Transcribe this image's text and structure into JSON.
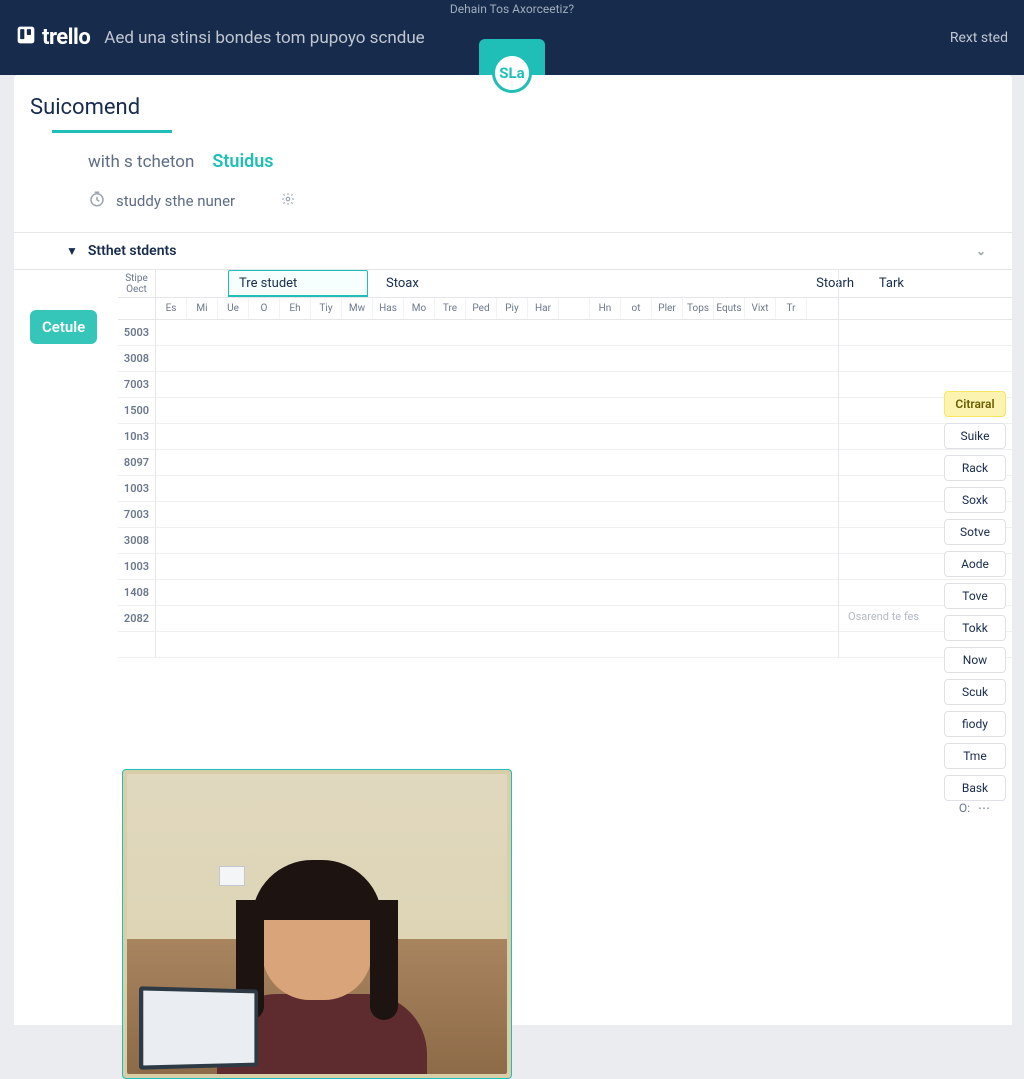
{
  "top": {
    "message": "Dehain Tos Axorceetiz?",
    "brand": "trello",
    "board_title": "Aed una stinsi bondes tom pupoyo scndue",
    "right_link": "Rext sted",
    "badge": "SLa"
  },
  "panel": {
    "title": "Suicomend",
    "sub_mute": "with s tcheton",
    "sub_teal": "Stuidus",
    "study_label": "studdy sthe nuner"
  },
  "section": {
    "label": "Stthet stdents"
  },
  "table": {
    "active_tab": "Tre studet",
    "mid_label": "Stoax",
    "right_a": "Stoarh",
    "right_b": "Tark",
    "timecol_header": "Stipe Oect",
    "ghost": "Osarend te fes",
    "days": [
      "Es",
      "Mi",
      "Ue",
      "O",
      "Eh",
      "Tiy",
      "Mw",
      "Has",
      "Mo",
      "Tre",
      "Ped",
      "Piy",
      "Har",
      "",
      "Hn",
      "ot",
      "Pler",
      "Tops",
      "Equts",
      "Vixt",
      "Tr"
    ],
    "times": [
      "5003",
      "3008",
      "7003",
      "1500",
      "10n3",
      "8097",
      "1003",
      "7003",
      "3008",
      "1003",
      "1408",
      "2082",
      ""
    ]
  },
  "actions": {
    "left_button": "Cetule",
    "primary": "Citraral",
    "items": [
      "Suike",
      "Rack",
      "Soxk",
      "Sotve",
      "Aode",
      "Tove",
      "Tokk",
      "Now",
      "Scuk",
      "fiody",
      "Tme",
      "Bask"
    ],
    "close": "O:"
  }
}
